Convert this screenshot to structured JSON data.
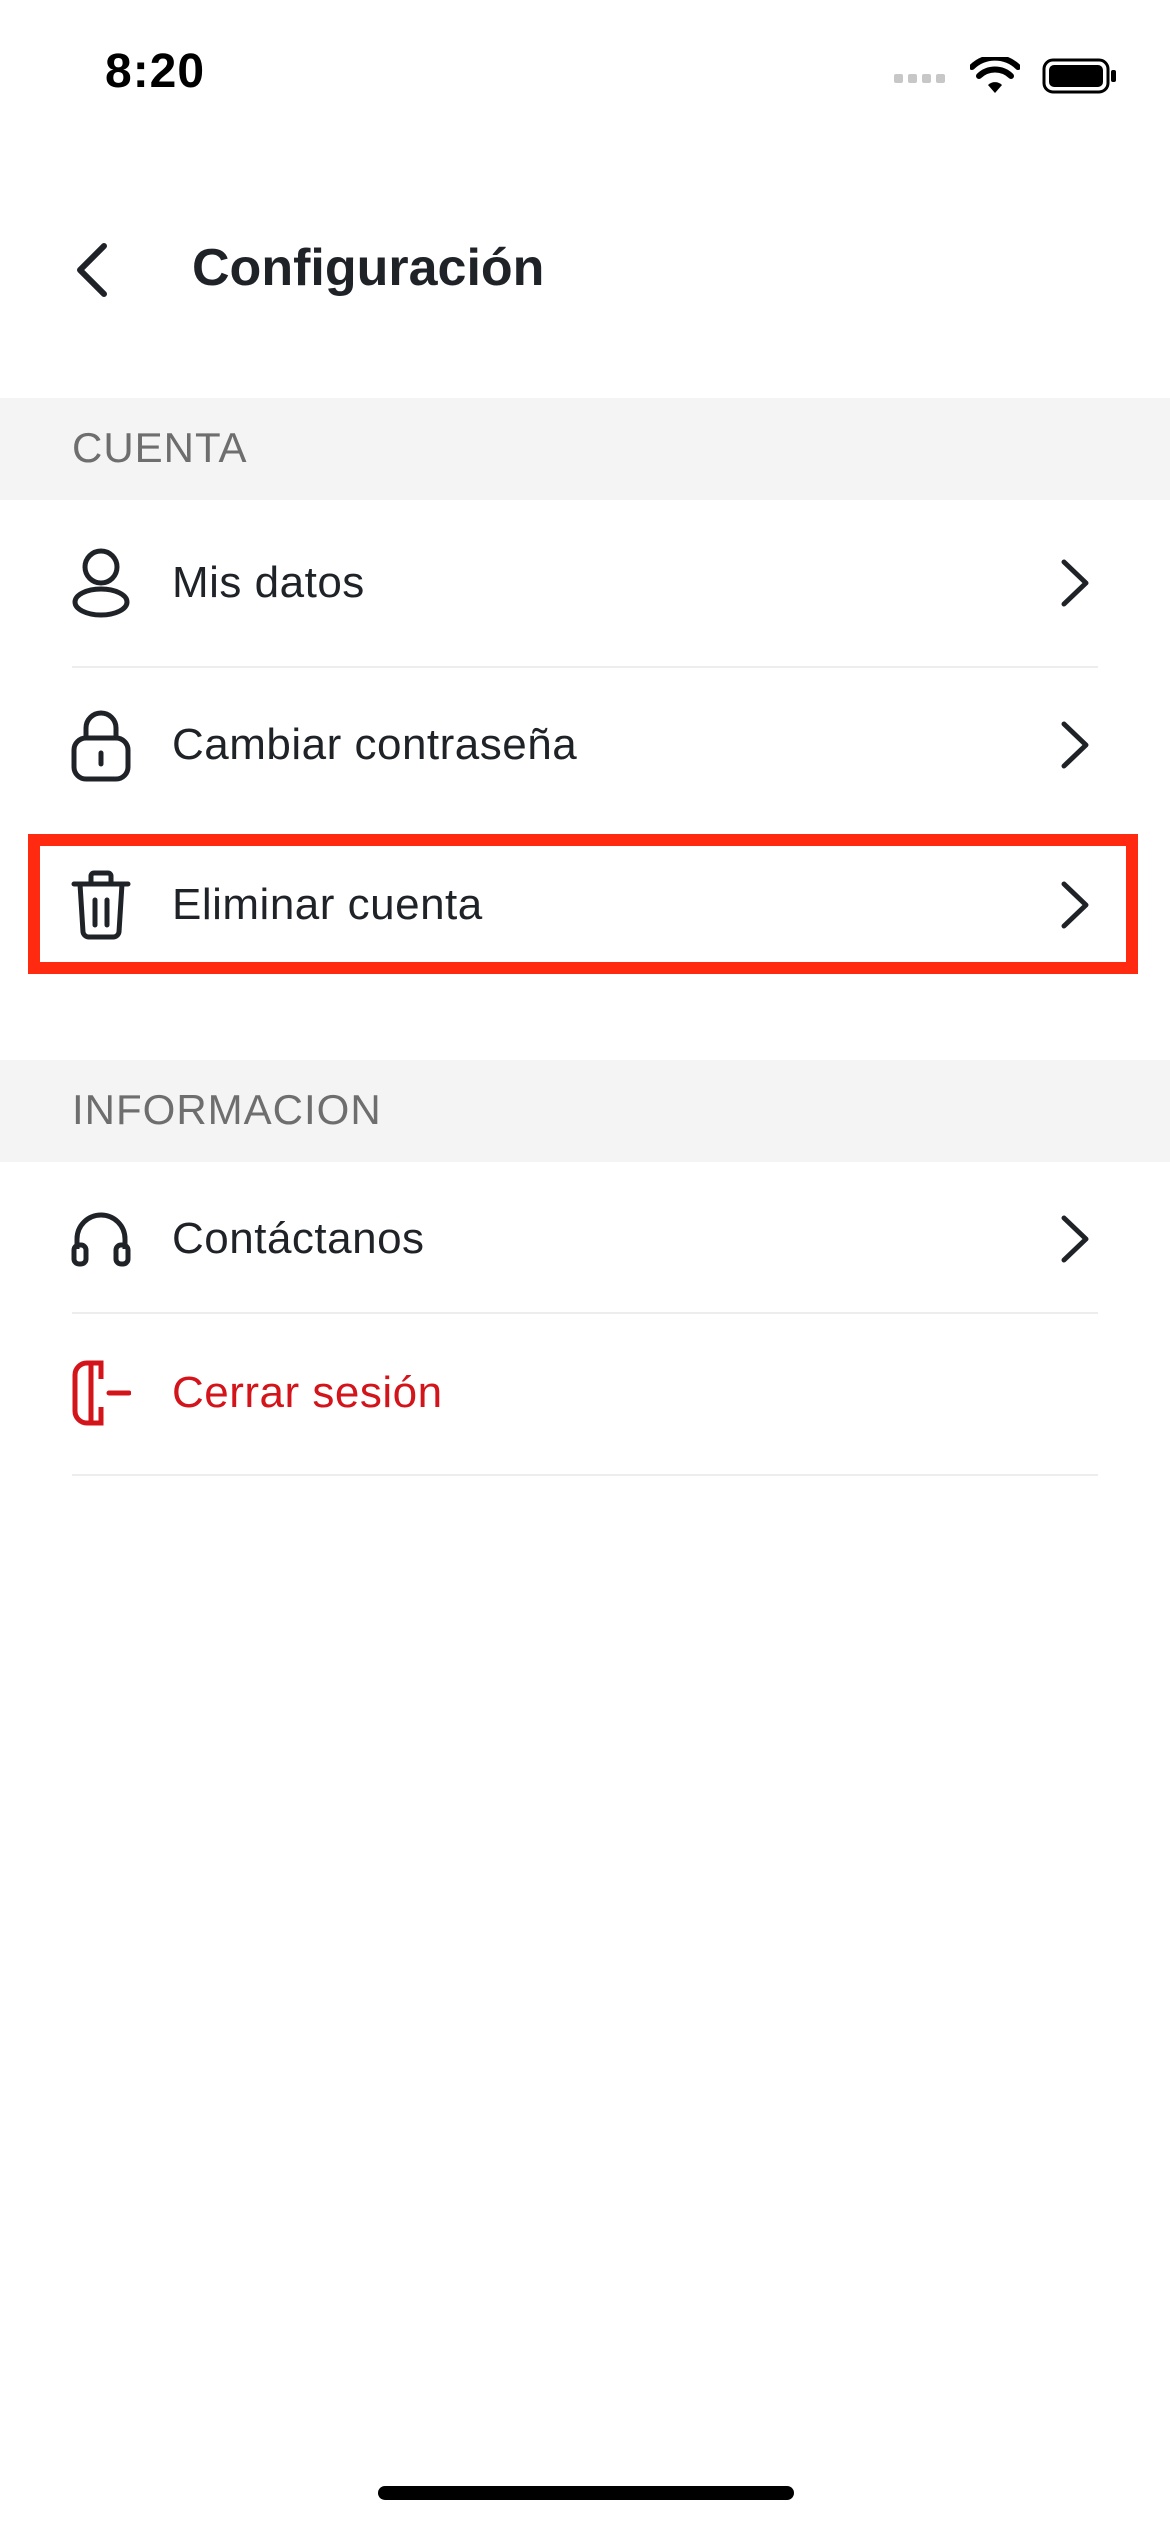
{
  "status_bar": {
    "time": "8:20"
  },
  "header": {
    "title": "Configuración"
  },
  "sections": {
    "cuenta": {
      "title": "CUENTA",
      "items": [
        {
          "label": "Mis datos",
          "icon": "user-icon"
        },
        {
          "label": "Cambiar contraseña",
          "icon": "lock-icon"
        },
        {
          "label": "Eliminar cuenta",
          "icon": "trash-icon"
        }
      ]
    },
    "informacion": {
      "title": "INFORMACION",
      "items": [
        {
          "label": "Contáctanos",
          "icon": "headset-icon"
        },
        {
          "label": "Cerrar sesión",
          "icon": "logout-icon"
        }
      ]
    }
  },
  "colors": {
    "danger": "#d3141b",
    "highlight": "#ff2a10",
    "section_bg": "#f4f4f4"
  }
}
